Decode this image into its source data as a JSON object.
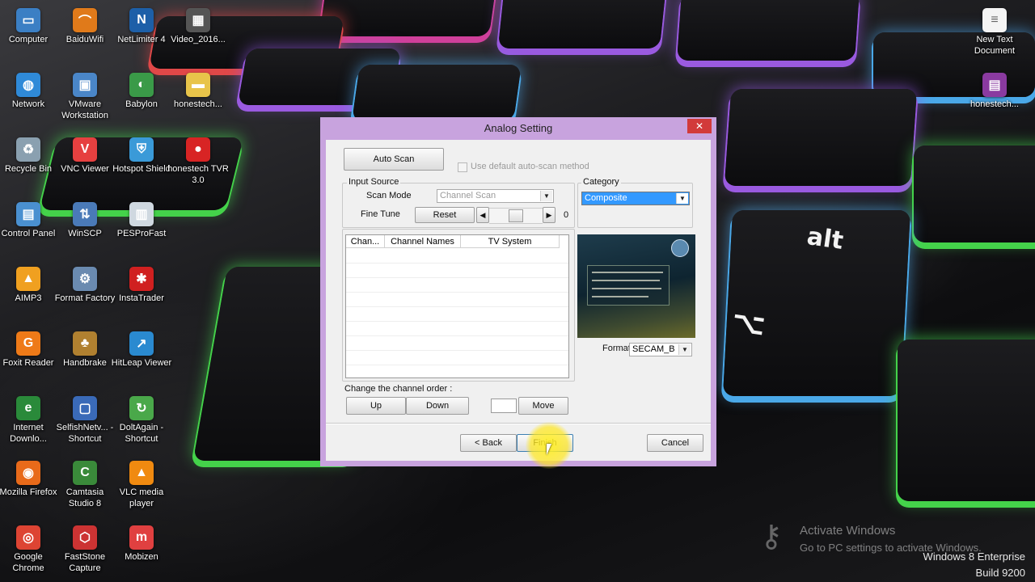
{
  "desktop": {
    "icons": [
      {
        "label": "Computer",
        "icon": "computer-icon",
        "color": "#3b7fc4",
        "glyph": "▭"
      },
      {
        "label": "BaiduWifi",
        "icon": "baiduwifi-icon",
        "color": "#e07a1a",
        "glyph": "⌒"
      },
      {
        "label": "NetLimiter 4",
        "icon": "netlimiter-icon",
        "color": "#1d5fa8",
        "glyph": "N"
      },
      {
        "label": "Video_2016...",
        "icon": "video-file-icon",
        "color": "#555555",
        "glyph": "▦"
      },
      {
        "label": "Network",
        "icon": "network-icon",
        "color": "#2f8ad8",
        "glyph": "◍"
      },
      {
        "label": "VMware Workstation",
        "icon": "vmware-icon",
        "color": "#4a86c8",
        "glyph": "▣"
      },
      {
        "label": "Babylon",
        "icon": "babylon-icon",
        "color": "#3a9a48",
        "glyph": "◐"
      },
      {
        "label": "honestech...",
        "icon": "folder-icon",
        "color": "#e8c44a",
        "glyph": "▬"
      },
      {
        "label": "Recycle Bin",
        "icon": "recycle-bin-icon",
        "color": "#8aa0b0",
        "glyph": "♻"
      },
      {
        "label": "VNC Viewer",
        "icon": "vnc-viewer-icon",
        "color": "#e64040",
        "glyph": "V"
      },
      {
        "label": "Hotspot Shield",
        "icon": "hotspot-shield-icon",
        "color": "#3a9ad8",
        "glyph": "⛨"
      },
      {
        "label": "honestech TVR 3.0",
        "icon": "honestech-tvr-icon",
        "color": "#d82424",
        "glyph": "●"
      },
      {
        "label": "Control Panel",
        "icon": "control-panel-icon",
        "color": "#4a90d0",
        "glyph": "▤"
      },
      {
        "label": "WinSCP",
        "icon": "winscp-icon",
        "color": "#4a7ab8",
        "glyph": "⇅"
      },
      {
        "label": "PESProFast",
        "icon": "pesprofast-icon",
        "color": "#cfd8e0",
        "glyph": "▥"
      },
      {
        "label": "AIMP3",
        "icon": "aimp3-icon",
        "color": "#f0a020",
        "glyph": "▲"
      },
      {
        "label": "Format Factory",
        "icon": "format-factory-icon",
        "color": "#6a8ab0",
        "glyph": "⚙"
      },
      {
        "label": "InstaTrader",
        "icon": "instatrader-icon",
        "color": "#d02020",
        "glyph": "✱"
      },
      {
        "label": "Foxit Reader",
        "icon": "foxit-reader-icon",
        "color": "#ee7a18",
        "glyph": "G"
      },
      {
        "label": "Handbrake",
        "icon": "handbrake-icon",
        "color": "#b08030",
        "glyph": "♣"
      },
      {
        "label": "HitLeap Viewer",
        "icon": "hitleap-icon",
        "color": "#2a8ad0",
        "glyph": "↗"
      },
      {
        "label": "Internet Downlo...",
        "icon": "internet-download-manager-icon",
        "color": "#2a8a3a",
        "glyph": "e"
      },
      {
        "label": "SelfishNetv... - Shortcut",
        "icon": "selfishnet-icon",
        "color": "#3a6ab8",
        "glyph": "▢"
      },
      {
        "label": "DoltAgain - Shortcut",
        "icon": "doitagain-icon",
        "color": "#4aa84a",
        "glyph": "↻"
      },
      {
        "label": "Mozilla Firefox",
        "icon": "firefox-icon",
        "color": "#e86a1a",
        "glyph": "◉"
      },
      {
        "label": "Camtasia Studio 8",
        "icon": "camtasia-icon",
        "color": "#3a8a3a",
        "glyph": "C"
      },
      {
        "label": "VLC media player",
        "icon": "vlc-icon",
        "color": "#f08a10",
        "glyph": "▲"
      },
      {
        "label": "Google Chrome",
        "icon": "chrome-icon",
        "color": "#dd4433",
        "glyph": "◎"
      },
      {
        "label": "FastStone Capture",
        "icon": "faststone-capture-icon",
        "color": "#cc3333",
        "glyph": "⬡"
      },
      {
        "label": "Mobizen",
        "icon": "mobizen-icon",
        "color": "#e04040",
        "glyph": "m"
      }
    ],
    "right_icons": [
      {
        "label": "New Text Document",
        "icon": "text-document-icon",
        "color": "#f4f4f4",
        "glyph": "≡"
      },
      {
        "label": "honestech...",
        "icon": "winrar-archive-icon",
        "color": "#8a3aa0",
        "glyph": "▤"
      }
    ],
    "watermark": {
      "title": "Activate Windows",
      "subtitle": "Go to PC settings to activate Windows."
    },
    "edition": "Windows 8 Enterprise",
    "build": "Build 9200"
  },
  "dialog": {
    "title": "Analog Setting",
    "close_label": "✕",
    "auto_scan_label": "Auto Scan",
    "default_method_label": "Use default auto-scan method",
    "input_source_label": "Input Source",
    "scan_mode_label": "Scan Mode",
    "scan_mode_value": "Channel Scan",
    "fine_tune_label": "Fine Tune",
    "reset_label": "Reset",
    "fine_tune_value": "0",
    "category_label": "Category",
    "category_value": "Composite",
    "columns": [
      "Chan...",
      "Channel Names",
      "TV System"
    ],
    "format_label": "Format",
    "format_value": "SECAM_B",
    "change_order_label": "Change the channel order :",
    "up_label": "Up",
    "down_label": "Down",
    "move_label": "Move",
    "back_label": "< Back",
    "finish_label": "Finish",
    "cancel_label": "Cancel"
  },
  "keyboard": {
    "alt_label": "alt"
  }
}
